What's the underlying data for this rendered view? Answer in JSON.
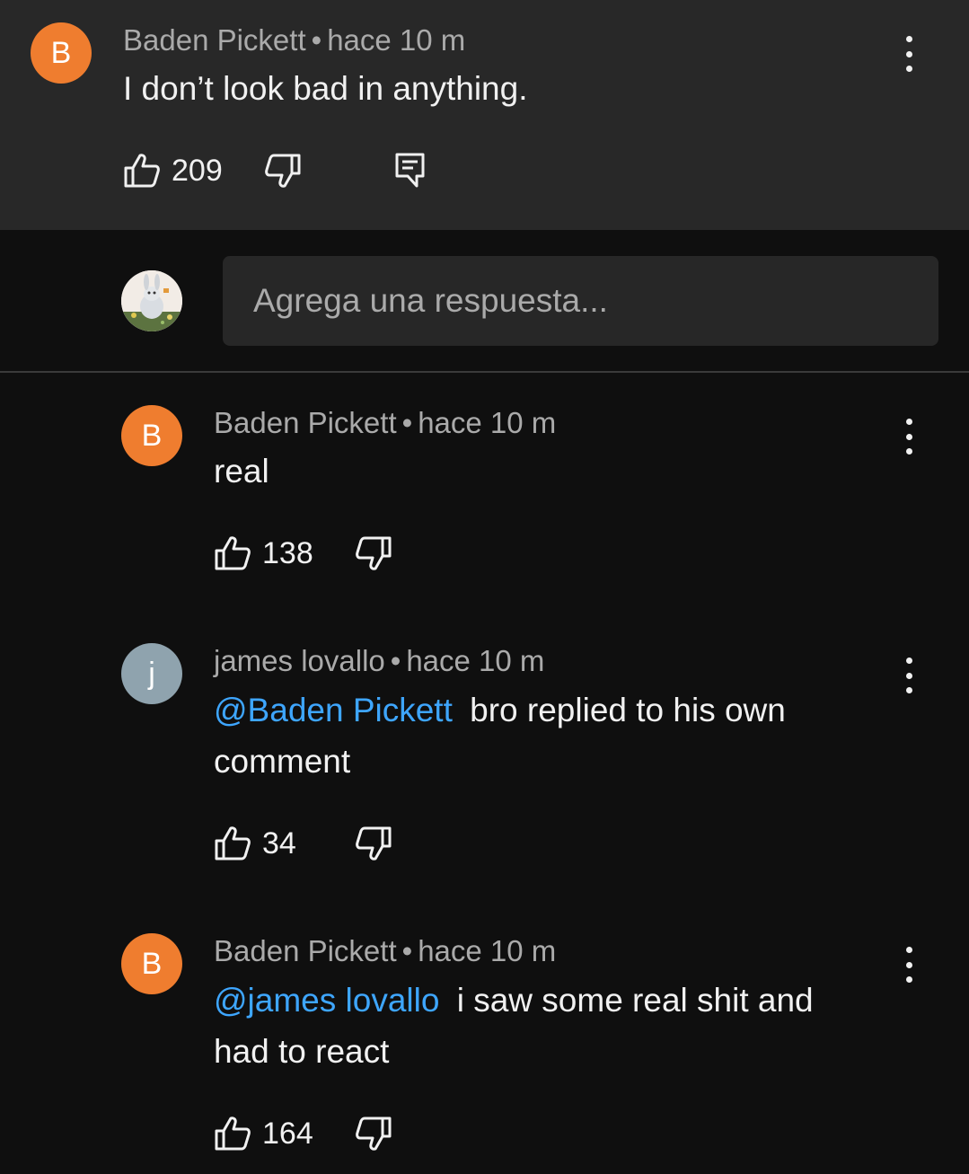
{
  "top_comment": {
    "avatar_letter": "B",
    "author": "Baden Pickett",
    "separator": "•",
    "time": "hace 10 m",
    "text": "I don’t look bad in anything.",
    "likes": "209"
  },
  "reply_box": {
    "placeholder": "Agrega una respuesta..."
  },
  "replies": [
    {
      "avatar_letter": "B",
      "author": "Baden Pickett",
      "separator": "•",
      "time": "hace 10 m",
      "text": "real",
      "likes": "138"
    },
    {
      "avatar_letter": "j",
      "author": "james lovallo",
      "separator": "•",
      "time": "hace 10 m",
      "mention": "@Baden Pickett",
      "text_line1": "bro replied to his own",
      "text_line2": "comment",
      "likes": "34"
    },
    {
      "avatar_letter": "B",
      "author": "Baden Pickett",
      "separator": "•",
      "time": "hace 10 m",
      "mention": "@james lovallo",
      "text_line1": "i saw some real shit and",
      "text_line2": "had to react",
      "likes": "164"
    }
  ],
  "colors": {
    "background": "#0f0f0f",
    "top_comment_bg": "#282828",
    "avatar_orange": "#ef7d2f",
    "avatar_grey": "#8fa3ae",
    "mention_blue": "#3ea6ff"
  },
  "icons": [
    "like-icon",
    "dislike-icon",
    "reply-icon",
    "more-options-icon"
  ]
}
